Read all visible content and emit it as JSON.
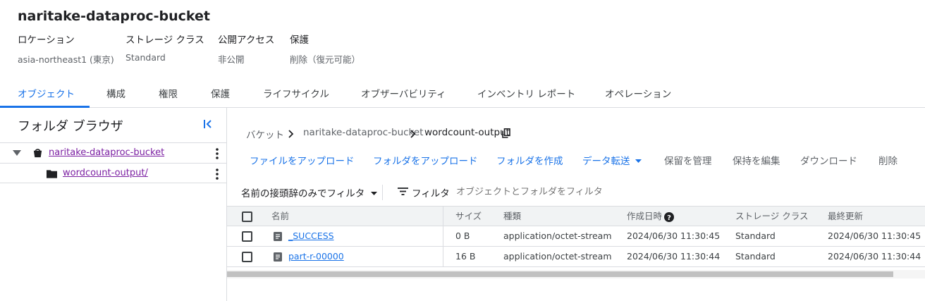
{
  "bucket": {
    "title": "naritake-dataproc-bucket",
    "meta": [
      {
        "label": "ロケーション",
        "value": "asia-northeast1 (東京)"
      },
      {
        "label": "ストレージ クラス",
        "value": "Standard"
      },
      {
        "label": "公開アクセス",
        "value": "非公開"
      },
      {
        "label": "保護",
        "value": "削除（復元可能）"
      }
    ]
  },
  "tabs": [
    "オブジェクト",
    "構成",
    "権限",
    "保護",
    "ライフサイクル",
    "オブザーバビリティ",
    "インベントリ レポート",
    "オペレーション"
  ],
  "folder_browser": {
    "title": "フォルダ ブラウザ",
    "tree": [
      "naritake-dataproc-bucket",
      "wordcount-output/"
    ]
  },
  "breadcrumb": {
    "root": "バケット",
    "bucket": "naritake-dataproc-bucket",
    "folder": "wordcount-output"
  },
  "actions": {
    "upload_files": "ファイルをアップロード",
    "upload_folder": "フォルダをアップロード",
    "create_folder": "フォルダを作成",
    "transfer": "データ転送",
    "manage_retention": "保留を管理",
    "edit_retention": "保持を編集",
    "download": "ダウンロード",
    "delete": "削除"
  },
  "filter": {
    "prefix_label": "名前の接頭辞のみでフィルタ",
    "filter_label": "フィルタ",
    "placeholder": "オブジェクトとフォルダをフィルタ"
  },
  "table": {
    "headers": [
      "名前",
      "サイズ",
      "種類",
      "作成日時",
      "ストレージ クラス",
      "最終更新"
    ],
    "rows": [
      {
        "name": "_SUCCESS",
        "size": "0 B",
        "type": "application/octet-stream",
        "created": "2024/06/30 11:30:45",
        "storage_class": "Standard",
        "updated": "2024/06/30 11:30:45"
      },
      {
        "name": "part-r-00000",
        "size": "16 B",
        "type": "application/octet-stream",
        "created": "2024/06/30 11:30:44",
        "storage_class": "Standard",
        "updated": "2024/06/30 11:30:44"
      }
    ]
  },
  "colors": {
    "accent": "#1a73e8",
    "visited_link": "#7b1fa2",
    "text": "#202124",
    "muted": "#5f6368",
    "divider": "#dadce0"
  }
}
